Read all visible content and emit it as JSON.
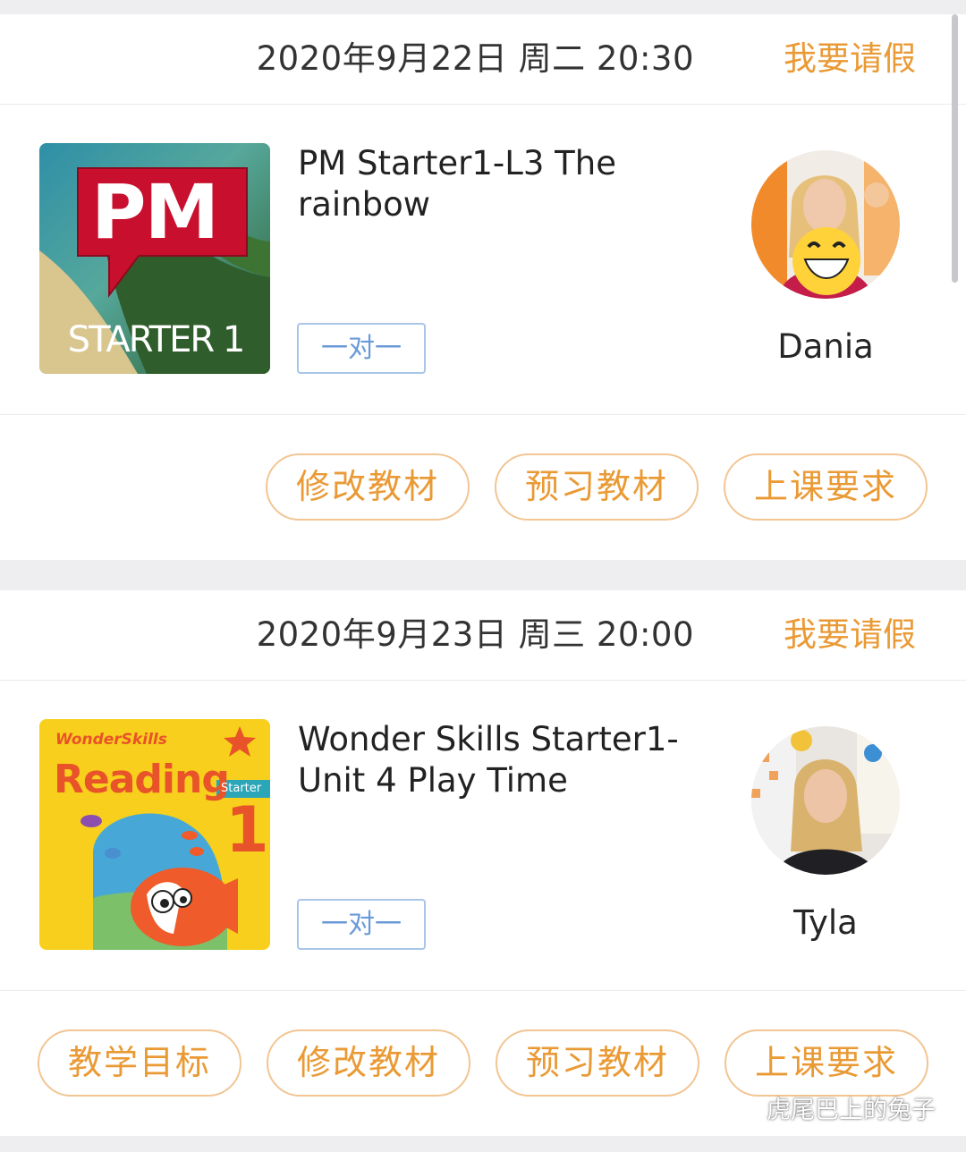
{
  "colors": {
    "accent": "#ea9a35",
    "button_border": "#f2c593",
    "badge": "#6a9ad7",
    "page_bg": "#eeeef1"
  },
  "lessons": [
    {
      "datetime": "2020年9月22日 周二 20:30",
      "leave_label": "我要请假",
      "cover": {
        "icon": "pm-starter-book-cover",
        "brand": "PM",
        "subtitle": "STARTER 1"
      },
      "title": "PM Starter1-L3 The rainbow",
      "badge": "一对一",
      "teacher": {
        "name": "Dania",
        "avatar": "teacher-avatar-icon"
      },
      "actions": [
        "修改教材",
        "预习教材",
        "上课要求"
      ]
    },
    {
      "datetime": "2020年9月23日 周三 20:00",
      "leave_label": "我要请假",
      "cover": {
        "icon": "wonderskills-reading-book-cover",
        "brand": "WonderSkills",
        "series": "Reading",
        "level_label": "Starter",
        "level": "1"
      },
      "title": "Wonder Skills Starter1-Unit 4 Play Time",
      "badge": "一对一",
      "teacher": {
        "name": "Tyla",
        "avatar": "teacher-avatar-icon"
      },
      "actions": [
        "教学目标",
        "修改教材",
        "预习教材",
        "上课要求"
      ]
    }
  ],
  "watermark": {
    "icon": "wechat-icon",
    "text": "虎尾巴上的兔子"
  }
}
